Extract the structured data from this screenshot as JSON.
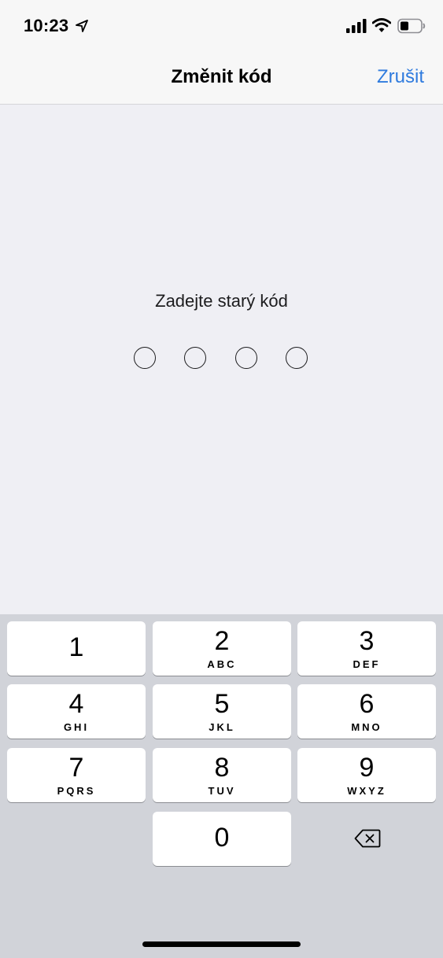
{
  "status_bar": {
    "time": "10:23",
    "icons": [
      "location-arrow-icon",
      "cellular-signal-icon",
      "wifi-icon",
      "battery-icon"
    ]
  },
  "nav": {
    "title": "Změnit kód",
    "cancel_label": "Zrušit"
  },
  "prompt": "Zadejte starý kód",
  "passcode": {
    "length": 4,
    "entered": 0
  },
  "keypad": {
    "keys": [
      {
        "digit": "1",
        "letters": ""
      },
      {
        "digit": "2",
        "letters": "ABC"
      },
      {
        "digit": "3",
        "letters": "DEF"
      },
      {
        "digit": "4",
        "letters": "GHI"
      },
      {
        "digit": "5",
        "letters": "JKL"
      },
      {
        "digit": "6",
        "letters": "MNO"
      },
      {
        "digit": "7",
        "letters": "PQRS"
      },
      {
        "digit": "8",
        "letters": "TUV"
      },
      {
        "digit": "9",
        "letters": "WXYZ"
      },
      {
        "digit": "0",
        "letters": ""
      }
    ],
    "delete_icon": "backspace-icon"
  },
  "colors": {
    "accent": "#2f7bde",
    "background": "#efeff4",
    "keypad_background": "#d1d3d9"
  }
}
